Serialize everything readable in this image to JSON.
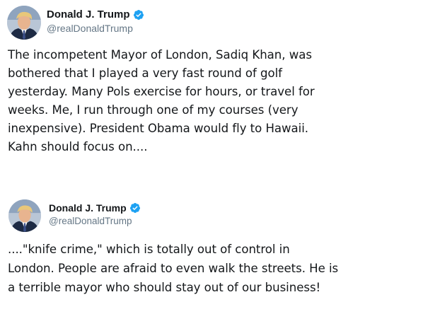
{
  "tweets": [
    {
      "author": {
        "name": "Donald J. Trump",
        "handle": "@realDonaldTrump",
        "verified_icon": "verified-badge-icon"
      },
      "text": "The incompetent Mayor of London, Sadiq Khan, was\nbothered that I played a very fast round of golf\nyesterday. Many Pols exercise for hours, or travel for\nweeks. Me, I run through one of my courses (very\ninexpensive). President Obama would fly to Hawaii.\nKahn should focus on...."
    },
    {
      "author": {
        "name": "Donald J. Trump",
        "handle": "@realDonaldTrump",
        "verified_icon": "verified-badge-icon"
      },
      "text": "....\"knife crime,\" which is totally out of control in\nLondon. People are afraid to even walk the streets. He is\na terrible mayor who should stay out of our business!"
    }
  ],
  "colors": {
    "text": "#14171a",
    "handle": "#657786",
    "verified": "#1da1f2",
    "background": "#ffffff"
  }
}
